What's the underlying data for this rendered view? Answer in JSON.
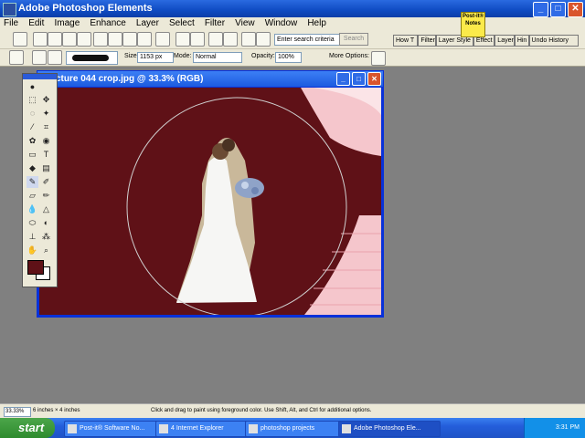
{
  "app": {
    "title": "Adobe Photoshop Elements",
    "min_label": "_",
    "max_label": "□",
    "close_label": "✕"
  },
  "menu": [
    "File",
    "Edit",
    "Image",
    "Enhance",
    "Layer",
    "Select",
    "Filter",
    "View",
    "Window",
    "Help"
  ],
  "toolbar": {
    "search_placeholder": "Enter search criteria",
    "search_button": "Search",
    "palette_tabs": [
      "How T",
      "Filter",
      "Layer Style",
      "Effect",
      "Layer",
      "Hin",
      "Undo History"
    ],
    "postit": "Post-it® Notes"
  },
  "options": {
    "size_label": "Size:",
    "size_value": "1153 px",
    "mode_label": "Mode:",
    "mode_value": "Normal",
    "opacity_label": "Opacity:",
    "opacity_value": "100%",
    "more_options_label": "More Options:"
  },
  "document": {
    "title": "cture 044 crop.jpg @ 33.3% (RGB)",
    "fill_color": "#5f1117"
  },
  "status": {
    "zoom": "33.33%",
    "doc_size": "6 inches × 4 inches",
    "hint": "Click and drag to paint using foreground color. Use Shift, Alt, and Ctrl for additional options."
  },
  "taskbar": {
    "start": "start",
    "tasks": [
      {
        "label": "Post-it® Software No..."
      },
      {
        "label": "4 Internet Explorer"
      },
      {
        "label": "photoshop projects"
      },
      {
        "label": "Adobe Photoshop Ele..."
      }
    ],
    "clock": "3:31 PM"
  },
  "colors": {
    "foreground": "#5f1117",
    "background": "#ffffff"
  }
}
